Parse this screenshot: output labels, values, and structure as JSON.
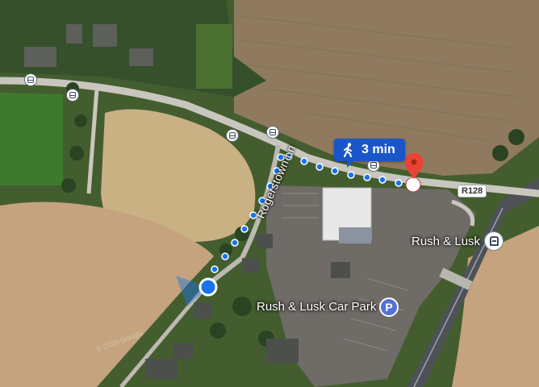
{
  "walk_time": "3 min",
  "walk_icon": "walking-person-icon",
  "road_label": "R128",
  "street_label": "Rogerstown Ln",
  "station_label": "Rush & Lusk",
  "station_icon": "train-station-icon",
  "car_park_label": "Rush & Lusk Car Park",
  "parking_icon": "parking-icon",
  "parking_symbol": "P",
  "destination_icon": "destination-pin-icon",
  "origin_icon": "current-location-icon",
  "bus_stop_icon": "bus-stop-icon",
  "watermark": "© 2020 Google",
  "colors": {
    "route_dots": "#1a73e8",
    "walk_chip": "#1a56c9",
    "pin": "#ea4335",
    "location_dot": "#1a73e8",
    "parking": "#5472d3",
    "road": "#c9c6bf"
  }
}
